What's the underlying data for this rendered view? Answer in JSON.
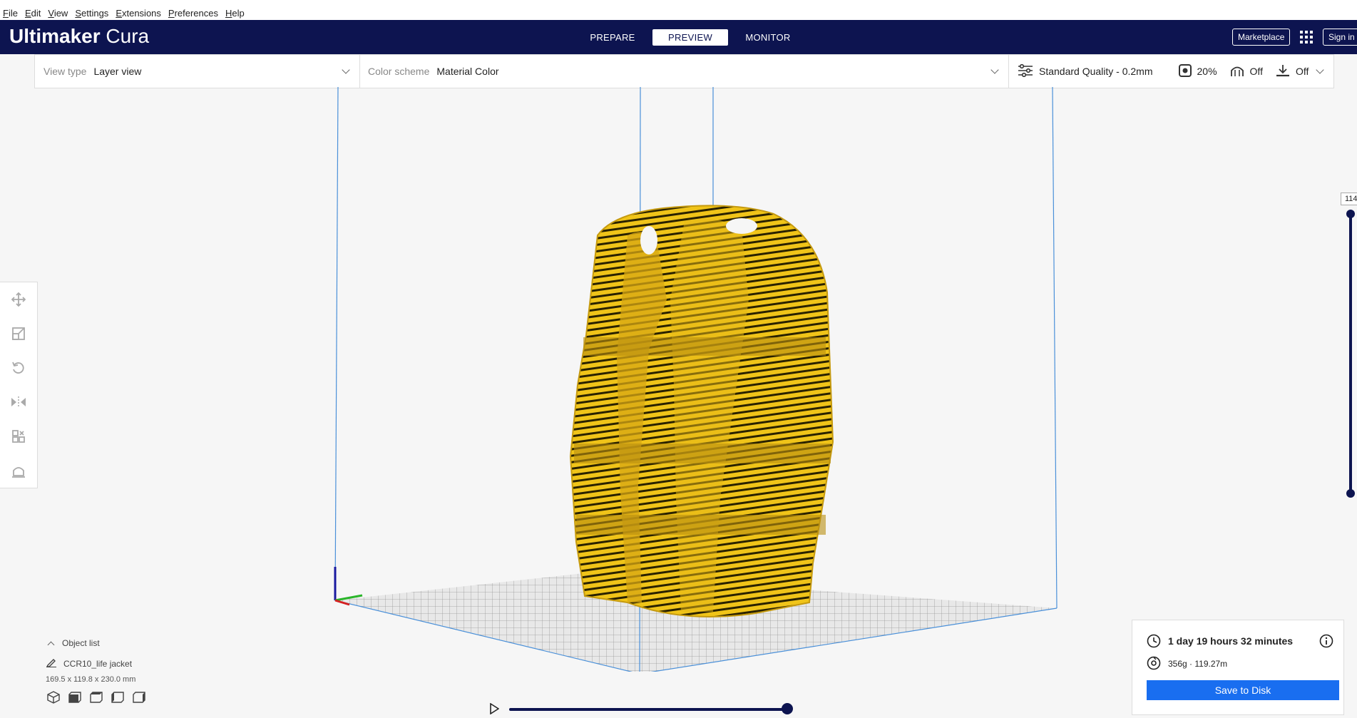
{
  "menu": [
    "File",
    "Edit",
    "View",
    "Settings",
    "Extensions",
    "Preferences",
    "Help"
  ],
  "brand": {
    "bold": "Ultimaker",
    "light": " Cura"
  },
  "stages": [
    {
      "label": "PREPARE"
    },
    {
      "label": "PREVIEW"
    },
    {
      "label": "MONITOR"
    }
  ],
  "header": {
    "marketplace": "Marketplace",
    "signin": "Sign in"
  },
  "toolbar": {
    "view_type_label": "View type",
    "view_type_value": "Layer view",
    "color_scheme_label": "Color scheme",
    "color_scheme_value": "Material Color",
    "quality": "Standard Quality - 0.2mm",
    "infill": "20%",
    "support": "Off",
    "adhesion": "Off"
  },
  "layer_slider": {
    "current_label": "114"
  },
  "object_list": {
    "title": "Object list",
    "object_name": "CCR10_life jacket",
    "dimensions": "169.5 x 119.8 x 230.0 mm"
  },
  "print_info": {
    "time": "1 day 19 hours 32 minutes",
    "material": "356g · 119.27m",
    "save_label": "Save to Disk"
  },
  "colors": {
    "header": "#0d1450",
    "accent": "#196ef0",
    "model": "#f0c419",
    "stripe": "#2a2200"
  },
  "icons": [
    "move-icon",
    "scale-icon",
    "rotate-icon",
    "mirror-icon",
    "per-model-settings-icon",
    "support-blocker-icon",
    "clock-icon",
    "spool-icon",
    "info-icon",
    "play-icon"
  ]
}
